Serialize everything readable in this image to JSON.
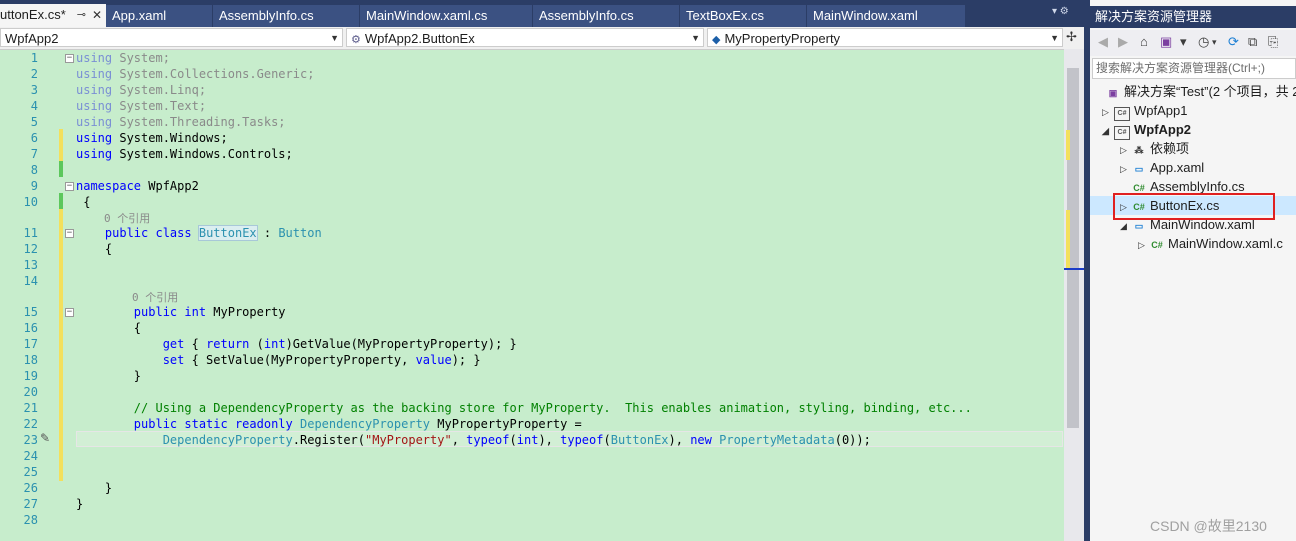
{
  "tabs": [
    {
      "label": "uttonEx.cs*",
      "pin": "⊸",
      "close": "✕"
    },
    {
      "label": "App.xaml"
    },
    {
      "label": "AssemblyInfo.cs"
    },
    {
      "label": "MainWindow.xaml.cs"
    },
    {
      "label": "AssemblyInfo.cs"
    },
    {
      "label": "TextBoxEx.cs"
    },
    {
      "label": "MainWindow.xaml"
    }
  ],
  "navbar": {
    "project": "WpfApp2",
    "class": "WpfApp2.ButtonEx",
    "member": "MyPropertyProperty"
  },
  "line_numbers": [
    "1",
    "2",
    "3",
    "4",
    "5",
    "6",
    "7",
    "8",
    "9",
    "10",
    "11",
    "12",
    "13",
    "14",
    "15",
    "16",
    "17",
    "18",
    "19",
    "20",
    "21",
    "22",
    "23",
    "24",
    "25",
    "26",
    "27",
    "28"
  ],
  "references": {
    "class_refs": "0 个引用",
    "prop_refs": "0 个引用"
  },
  "code": {
    "l1_kw": "using",
    "l1_rest": " System;",
    "l2_kw": "using",
    "l2_rest": " System.Collections.Generic;",
    "l3_kw": "using",
    "l3_rest": " System.Linq;",
    "l4_kw": "using",
    "l4_rest": " System.Text;",
    "l5_kw": "using",
    "l5_rest": " System.Threading.Tasks;",
    "l6_kw": "using",
    "l6_rest": " System.Windows;",
    "l7_kw": "using",
    "l7_rest": " System.Windows.Controls;",
    "l9_kw": "namespace",
    "l9_rest": " WpfApp2",
    "l10": " {",
    "l11_a": "    public",
    "l11_b": " class",
    "l11_c": "ButtonEx",
    "l11_d": " : ",
    "l11_e": "Button",
    "l12": "    {",
    "l15_a": "        public",
    "l15_b": " int",
    "l15_c": " MyProperty",
    "l16": "        {",
    "l17_a": "            get",
    "l17_b": " { ",
    "l17_c": "return",
    "l17_d": " (",
    "l17_e": "int",
    "l17_f": ")GetValue(MyPropertyProperty); }",
    "l18_a": "            set",
    "l18_b": " { SetValue(MyPropertyProperty, ",
    "l18_c": "value",
    "l18_d": "); }",
    "l19": "        }",
    "l21": "        // Using a DependencyProperty as the backing store for MyProperty.  This enables animation, styling, binding, etc...",
    "l22_a": "        public",
    "l22_b": " static",
    "l22_c": " readonly",
    "l22_d": " DependencyProperty",
    "l22_e": " MyPropertyProperty =",
    "l23_a": "            DependencyProperty",
    "l23_b": ".Register(",
    "l23_c": "\"MyProperty\"",
    "l23_d": ", ",
    "l23_e": "typeof",
    "l23_f": "(",
    "l23_g": "int",
    "l23_h": "), ",
    "l23_i": "typeof",
    "l23_j": "(",
    "l23_k": "ButtonEx",
    "l23_l": "), ",
    "l23_m": "new",
    "l23_n": " PropertyMetadata",
    "l23_o": "(0));",
    "l26": "    }",
    "l27": "}"
  },
  "solution": {
    "title": "解决方案资源管理器",
    "search_placeholder": "搜索解决方案资源管理器(Ctrl+;)",
    "items": [
      {
        "label": "解决方案“Test”(2 个项目，共 2"
      },
      {
        "label": "WpfApp1"
      },
      {
        "label": "WpfApp2"
      },
      {
        "label": "依赖项"
      },
      {
        "label": "App.xaml"
      },
      {
        "label": "AssemblyInfo.cs"
      },
      {
        "label": "ButtonEx.cs"
      },
      {
        "label": "MainWindow.xaml"
      },
      {
        "label": "MainWindow.xaml.c"
      }
    ]
  },
  "watermark": "CSDN @故里2130",
  "colors": {
    "accent": "#2b3d66",
    "editor_bg": "#c7edcc",
    "highlight": "#e02020"
  }
}
